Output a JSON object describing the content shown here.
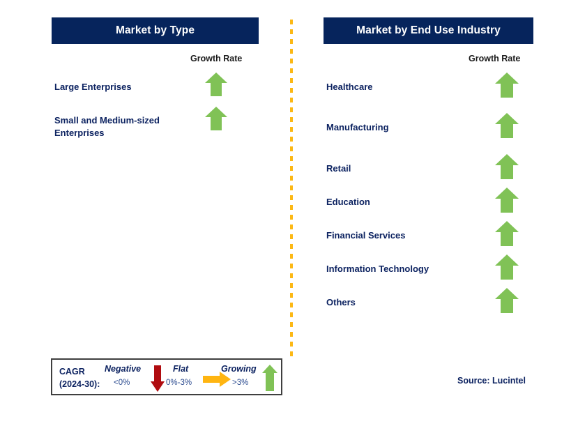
{
  "panels": [
    {
      "id": "market-by-type",
      "title": "Market by Type",
      "growth_rate_label": "Growth Rate",
      "rows": [
        {
          "label": "Large Enterprises",
          "trend": "growing",
          "trend_icon": "arrow-up-icon"
        },
        {
          "label": "Small and Medium-sized\nEnterprises",
          "trend": "growing",
          "trend_icon": "arrow-up-icon"
        }
      ]
    },
    {
      "id": "market-by-end-use-industry",
      "title": "Market by End Use Industry",
      "growth_rate_label": "Growth Rate",
      "rows": [
        {
          "label": "Healthcare",
          "trend": "growing",
          "trend_icon": "arrow-up-icon"
        },
        {
          "label": "Manufacturing",
          "trend": "growing",
          "trend_icon": "arrow-up-icon"
        },
        {
          "label": "Retail",
          "trend": "growing",
          "trend_icon": "arrow-up-icon"
        },
        {
          "label": "Education",
          "trend": "growing",
          "trend_icon": "arrow-up-icon"
        },
        {
          "label": "Financial Services",
          "trend": "growing",
          "trend_icon": "arrow-up-icon"
        },
        {
          "label": "Information Technology",
          "trend": "growing",
          "trend_icon": "arrow-up-icon"
        },
        {
          "label": "Others",
          "trend": "growing",
          "trend_icon": "arrow-up-icon"
        }
      ]
    }
  ],
  "legend": {
    "title_line1": "CAGR",
    "title_line2": "(2024-30):",
    "entries": [
      {
        "term": "Negative",
        "range": "<0%",
        "icon": "arrow-down-icon",
        "color": "#b00c10"
      },
      {
        "term": "Flat",
        "range": "0%-3%",
        "icon": "arrow-right-icon",
        "color": "#ffb511"
      },
      {
        "term": "Growing",
        "range": ">3%",
        "icon": "arrow-up-icon",
        "color": "#80c256"
      }
    ]
  },
  "source": "Source: Lucintel",
  "colors": {
    "header_bar": "#06245c",
    "label_text": "#0d2361",
    "growth_caption": "#1a1a1a",
    "arrow_growing": "#80c256",
    "arrow_negative": "#b00c10",
    "arrow_flat": "#ffb511",
    "divider_dash": "#fcb814",
    "legend_border": "#3f3f3f",
    "background": "#ffffff"
  }
}
